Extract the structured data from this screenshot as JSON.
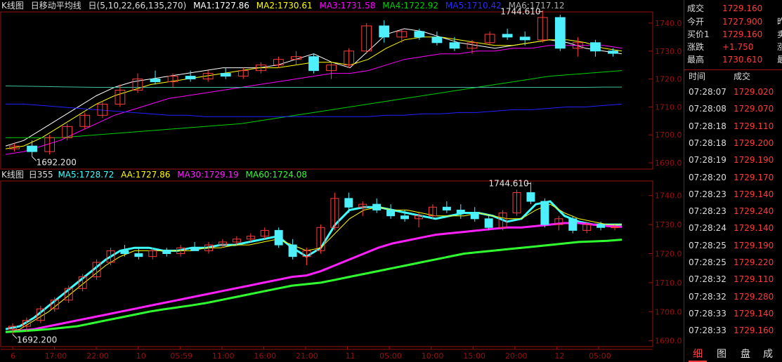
{
  "colors": {
    "frame": "#9a1010",
    "up": "#ff3b3b",
    "down": "#4ef0ff",
    "ma5": "#ffffff",
    "ma10": "#ffff00",
    "ma22": "#ff00ff",
    "ma66": "#00d000",
    "ma135": "#2020ff",
    "ma270": "#40c0a0",
    "b_ma5": "#40ffff",
    "b_aa": "#ffff00",
    "b_ma30": "#ff20ff",
    "b_ma60": "#30ff30"
  },
  "top_legend": {
    "title": "K线图",
    "indicator": "日移动平均线",
    "params": "日(5,10,22,66,135,270)",
    "ma1": "MA1:1727.86",
    "ma2": "MA2:1730.61",
    "ma3": "MA3:1731.58",
    "ma4": "MA4:1722.92",
    "ma5": "MA5:1710.42",
    "ma6": "MA6:1717.12"
  },
  "bottom_legend": {
    "title": "K线图",
    "period": "日355",
    "ma5": "MA5:1728.72",
    "aa": "AA:1727.86",
    "ma30": "MA30:1729.19",
    "ma60": "MA60:1724.08"
  },
  "chart_data": [
    {
      "type": "candlestick",
      "panel": "top",
      "y_ticks": [
        "1740.0",
        "1730.0",
        "1720.0",
        "1710.0",
        "1700.0",
        "1690.0"
      ],
      "ylim": [
        1688,
        1744
      ],
      "annotations": [
        {
          "label": "1744.610",
          "value": 1744.61
        },
        {
          "label": "1692.200",
          "value": 1692.2
        }
      ],
      "series": [
        {
          "name": "MA1",
          "values": [
            1696,
            1698,
            1702,
            1706,
            1710,
            1714,
            1717,
            1719,
            1720,
            1721,
            1722,
            1723,
            1724,
            1724,
            1724,
            1725,
            1727,
            1729,
            1726,
            1724,
            1730,
            1736,
            1738,
            1737,
            1735,
            1733,
            1732,
            1731,
            1732,
            1733,
            1734,
            1733,
            1731,
            1730,
            1729
          ]
        },
        {
          "name": "MA2",
          "values": [
            1695,
            1696,
            1699,
            1703,
            1707,
            1711,
            1714,
            1716,
            1718,
            1719,
            1720,
            1721,
            1722,
            1723,
            1724,
            1724,
            1725,
            1726,
            1726,
            1725,
            1727,
            1731,
            1734,
            1735,
            1735,
            1734,
            1733,
            1732,
            1732,
            1733,
            1734,
            1734,
            1733,
            1731,
            1730
          ]
        },
        {
          "name": "MA3",
          "values": [
            1693,
            1694,
            1696,
            1698,
            1701,
            1704,
            1707,
            1709,
            1711,
            1713,
            1714,
            1715,
            1716,
            1717,
            1718,
            1719,
            1720,
            1721,
            1722,
            1722,
            1723,
            1725,
            1727,
            1728,
            1729,
            1729,
            1730,
            1730,
            1731,
            1731,
            1732,
            1732,
            1732,
            1732,
            1731
          ]
        },
        {
          "name": "MA4",
          "values": [
            1699,
            1699,
            1699,
            1699,
            1699.5,
            1700,
            1700.5,
            1701,
            1701.5,
            1702,
            1702.5,
            1703,
            1703.5,
            1704,
            1705,
            1706,
            1707,
            1708,
            1709,
            1710,
            1711,
            1712,
            1713,
            1714,
            1715,
            1716,
            1717,
            1718,
            1719,
            1720,
            1721,
            1721.5,
            1722,
            1722.5,
            1723
          ]
        },
        {
          "name": "MA5",
          "values": [
            1711,
            1711,
            1710.5,
            1710,
            1709.5,
            1709,
            1708.5,
            1708,
            1707.5,
            1707,
            1707,
            1706.5,
            1706.5,
            1706.5,
            1706.5,
            1706.5,
            1706.5,
            1706.5,
            1706.5,
            1706.5,
            1706.5,
            1707,
            1707,
            1707.5,
            1707.5,
            1708,
            1708,
            1708.5,
            1709,
            1709,
            1709.5,
            1710,
            1710,
            1710.5,
            1711
          ]
        },
        {
          "name": "MA6",
          "values": [
            1717.5,
            1717.4,
            1717.3,
            1717.2,
            1717.1,
            1717,
            1717,
            1717,
            1717,
            1717,
            1717,
            1717,
            1717,
            1717,
            1717,
            1717,
            1717,
            1717,
            1717,
            1717,
            1717,
            1717,
            1717,
            1717,
            1717,
            1717,
            1717,
            1717,
            1717,
            1717,
            1717,
            1717,
            1717,
            1717.1,
            1717.1
          ]
        }
      ],
      "candles": [
        [
          1695,
          1697,
          1694,
          1696
        ],
        [
          1696,
          1698,
          1692.2,
          1694
        ],
        [
          1694,
          1700,
          1693,
          1699
        ],
        [
          1699,
          1704,
          1698,
          1703
        ],
        [
          1703,
          1708,
          1702,
          1707
        ],
        [
          1707,
          1712,
          1706,
          1711
        ],
        [
          1711,
          1718,
          1710,
          1716
        ],
        [
          1716,
          1722,
          1715,
          1720
        ],
        [
          1720,
          1723,
          1718,
          1719
        ],
        [
          1719,
          1722,
          1717,
          1721
        ],
        [
          1721,
          1723,
          1719,
          1720
        ],
        [
          1720,
          1723,
          1719,
          1722
        ],
        [
          1722,
          1724,
          1720,
          1721
        ],
        [
          1721,
          1724,
          1720,
          1723
        ],
        [
          1723,
          1726,
          1722,
          1725
        ],
        [
          1725,
          1728,
          1724,
          1727
        ],
        [
          1727,
          1730,
          1725,
          1728
        ],
        [
          1728,
          1729,
          1722,
          1723
        ],
        [
          1723,
          1726,
          1720,
          1725
        ],
        [
          1725,
          1731,
          1724,
          1730
        ],
        [
          1730,
          1740,
          1729,
          1739
        ],
        [
          1739,
          1741,
          1733,
          1735
        ],
        [
          1735,
          1738,
          1733,
          1737
        ],
        [
          1737,
          1738,
          1734,
          1735
        ],
        [
          1735,
          1737,
          1732,
          1733
        ],
        [
          1733,
          1735,
          1730,
          1731
        ],
        [
          1731,
          1734,
          1729,
          1733
        ],
        [
          1733,
          1737,
          1732,
          1736
        ],
        [
          1736,
          1738,
          1734,
          1735
        ],
        [
          1735,
          1737,
          1732,
          1734
        ],
        [
          1734,
          1744.61,
          1733,
          1742
        ],
        [
          1742,
          1743,
          1730,
          1731
        ],
        [
          1731,
          1735,
          1728,
          1733
        ],
        [
          1733,
          1734,
          1728,
          1730
        ],
        [
          1730,
          1731,
          1728,
          1729.16
        ]
      ]
    },
    {
      "type": "candlestick",
      "panel": "bottom",
      "y_ticks": [
        "1740.0",
        "1730.0",
        "1720.0",
        "1710.0",
        "1700.0",
        "1690.0"
      ],
      "ylim": [
        1688,
        1745
      ],
      "x_ticks": [
        "6",
        "17:00",
        "22:00",
        "10",
        "05:59",
        "11:00",
        "16:00",
        "21:00",
        "11",
        "05:00",
        "10:00",
        "15:00",
        "20:00",
        "12",
        "05:00"
      ],
      "annotations": [
        {
          "label": "1744.610",
          "value": 1744.61
        },
        {
          "label": "1692.200",
          "value": 1692.2
        }
      ],
      "series": [
        {
          "name": "MA5",
          "values": [
            1694,
            1695,
            1698,
            1702,
            1706,
            1710,
            1714,
            1718,
            1721,
            1722,
            1722,
            1721,
            1721,
            1722,
            1722,
            1723,
            1723,
            1724,
            1725,
            1726,
            1722,
            1719,
            1722,
            1730,
            1735,
            1736,
            1736,
            1735,
            1734,
            1733,
            1732,
            1733,
            1734,
            1734,
            1733,
            1731,
            1732,
            1737,
            1738,
            1733,
            1731,
            1730,
            1730,
            1730
          ]
        },
        {
          "name": "AA",
          "values": [
            1693,
            1694,
            1697,
            1700,
            1704,
            1708,
            1712,
            1716,
            1719,
            1721,
            1721,
            1721,
            1721,
            1721,
            1722,
            1722,
            1723,
            1723,
            1724,
            1725,
            1723,
            1721,
            1722,
            1727,
            1732,
            1735,
            1736,
            1735,
            1735,
            1734,
            1733,
            1733,
            1733,
            1734,
            1733,
            1732,
            1732,
            1735,
            1737,
            1734,
            1732,
            1731,
            1730,
            1730
          ]
        },
        {
          "name": "MA30",
          "values": [
            1693,
            1693.5,
            1694,
            1695,
            1696,
            1697,
            1698,
            1699,
            1700,
            1701,
            1702,
            1703,
            1704,
            1705,
            1706,
            1707,
            1708,
            1709,
            1710,
            1711,
            1712,
            1712.5,
            1714,
            1716,
            1718,
            1720,
            1722,
            1723.5,
            1724.5,
            1725.5,
            1726.5,
            1727,
            1727.5,
            1728,
            1728.5,
            1729,
            1729,
            1729.5,
            1730,
            1730.5,
            1730.5,
            1730,
            1729.5,
            1729.2
          ]
        },
        {
          "name": "MA60",
          "values": [
            1693,
            1693.3,
            1693.6,
            1694,
            1694.5,
            1695,
            1696,
            1697,
            1698,
            1699,
            1700,
            1700.8,
            1701.5,
            1702.2,
            1703,
            1704,
            1705,
            1706,
            1707,
            1708,
            1709,
            1709.5,
            1710,
            1711,
            1712,
            1713,
            1714,
            1715,
            1716,
            1717,
            1718,
            1719,
            1720,
            1720.5,
            1721,
            1721.5,
            1722,
            1722.5,
            1723,
            1723.5,
            1724,
            1724.2,
            1724.4,
            1724.8
          ]
        }
      ],
      "candles": [
        [
          1694,
          1696,
          1692.2,
          1695
        ],
        [
          1695,
          1698,
          1693,
          1697
        ],
        [
          1697,
          1702,
          1696,
          1701
        ],
        [
          1701,
          1705,
          1700,
          1704
        ],
        [
          1704,
          1709,
          1703,
          1708
        ],
        [
          1708,
          1713,
          1707,
          1712
        ],
        [
          1712,
          1718,
          1711,
          1717
        ],
        [
          1717,
          1722,
          1716,
          1721
        ],
        [
          1721,
          1723,
          1719,
          1720
        ],
        [
          1720,
          1722,
          1718,
          1719
        ],
        [
          1719,
          1722,
          1718,
          1721
        ],
        [
          1721,
          1722,
          1719,
          1720
        ],
        [
          1720,
          1723,
          1719,
          1722
        ],
        [
          1722,
          1724,
          1721,
          1721
        ],
        [
          1721,
          1724,
          1720,
          1723
        ],
        [
          1723,
          1725,
          1722,
          1724
        ],
        [
          1724,
          1726,
          1723,
          1725
        ],
        [
          1725,
          1727,
          1724,
          1726
        ],
        [
          1726,
          1729,
          1725,
          1728
        ],
        [
          1728,
          1729,
          1722,
          1723
        ],
        [
          1723,
          1725,
          1718,
          1719
        ],
        [
          1719,
          1722,
          1716,
          1721
        ],
        [
          1721,
          1730,
          1720,
          1729
        ],
        [
          1729,
          1741,
          1728,
          1739
        ],
        [
          1739,
          1741,
          1734,
          1736
        ],
        [
          1736,
          1738,
          1733,
          1737
        ],
        [
          1737,
          1739,
          1734,
          1735
        ],
        [
          1735,
          1737,
          1732,
          1733
        ],
        [
          1733,
          1735,
          1731,
          1732
        ],
        [
          1732,
          1734,
          1729,
          1733
        ],
        [
          1733,
          1737,
          1732,
          1736
        ],
        [
          1736,
          1738,
          1734,
          1735
        ],
        [
          1735,
          1737,
          1732,
          1734
        ],
        [
          1734,
          1736,
          1731,
          1732
        ],
        [
          1732,
          1733,
          1728,
          1729
        ],
        [
          1729,
          1735,
          1728,
          1734
        ],
        [
          1734,
          1742,
          1733,
          1741
        ],
        [
          1741,
          1744.61,
          1737,
          1738
        ],
        [
          1738,
          1739,
          1729,
          1730
        ],
        [
          1730,
          1733,
          1728,
          1732
        ],
        [
          1732,
          1733,
          1727,
          1728
        ],
        [
          1728,
          1731,
          1727,
          1730
        ],
        [
          1730,
          1731,
          1728,
          1729
        ],
        [
          1729,
          1730,
          1728,
          1729.16
        ]
      ]
    }
  ],
  "quote": [
    {
      "label": "成交",
      "value": "1729.160",
      "cut": ""
    },
    {
      "label": "今开",
      "value": "1727.900",
      "cut": "昨"
    },
    {
      "label": "买价1",
      "value": "1729.160",
      "cut": "卖"
    },
    {
      "label": "涨跌",
      "value": "+1.750",
      "cut": "涨"
    },
    {
      "label": "最高",
      "value": "1730.610",
      "cut": "最"
    }
  ],
  "ticks_header": {
    "time": "时间",
    "price": "成交"
  },
  "ticks": [
    {
      "time": "07:28:07",
      "price": "1729.020"
    },
    {
      "time": "07:28:08",
      "price": "1729.070"
    },
    {
      "time": "07:28:18",
      "price": "1729.110"
    },
    {
      "time": "07:28:18",
      "price": "1729.200"
    },
    {
      "time": "07:28:19",
      "price": "1729.190"
    },
    {
      "time": "07:28:20",
      "price": "1729.170"
    },
    {
      "time": "07:28:23",
      "price": "1729.140"
    },
    {
      "time": "07:28:23",
      "price": "1729.240"
    },
    {
      "time": "07:28:24",
      "price": "1729.140"
    },
    {
      "time": "07:28:25",
      "price": "1729.190"
    },
    {
      "time": "07:28:25",
      "price": "1729.220"
    },
    {
      "time": "07:28:32",
      "price": "1729.110"
    },
    {
      "time": "07:28:32",
      "price": "1729.280"
    },
    {
      "time": "07:28:33",
      "price": "1729.140"
    },
    {
      "time": "07:28:33",
      "price": "1729.160"
    }
  ],
  "tabs": [
    "细",
    "图",
    "盘",
    "成"
  ]
}
